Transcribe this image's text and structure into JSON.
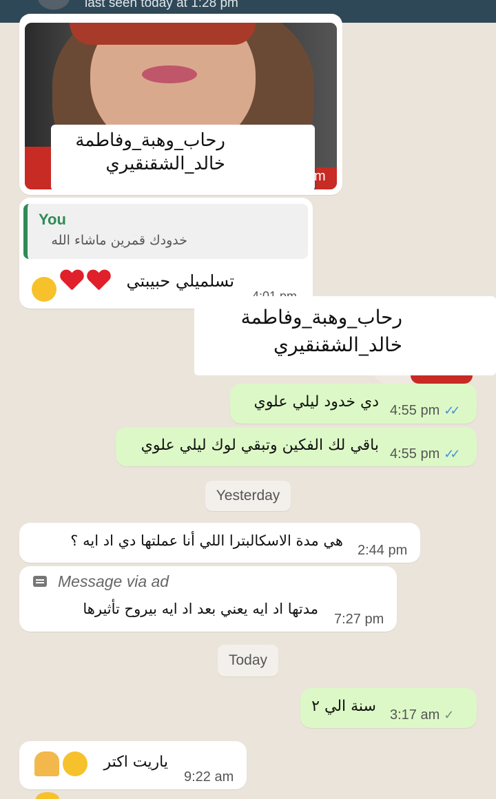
{
  "header": {
    "last_seen": "last seen today at 1:28 pm"
  },
  "photo_message": {
    "caption_line1": "رحاب_وهبة_وفاطمة",
    "caption_line2": "خالد_الشقنقيري",
    "time_fragment": "m"
  },
  "reply_message": {
    "quote_author": "You",
    "quote_text": "خدودك قمرين ماشاء الله",
    "text": "تسلميلي حبيبتي",
    "time_fragment": "4:01 pm"
  },
  "overlay_card": {
    "line1": "رحاب_وهبة_وفاطمة",
    "line2": "خالد_الشقنقيري"
  },
  "messages": [
    {
      "id": "m1",
      "direction": "out",
      "text": "دي خدود ليلي علوي",
      "time": "4:55 pm",
      "status": "read"
    },
    {
      "id": "m2",
      "direction": "out",
      "text": "باقي لك الفكين وتبقي لوك ليلي علوي",
      "time": "4:55 pm",
      "status": "read"
    },
    {
      "id": "m3",
      "direction": "in",
      "text": "هي مدة الاسكالبترا اللي أنا عملتها دي اد ايه ؟",
      "time": "2:44 pm"
    },
    {
      "id": "m4",
      "direction": "in",
      "ad_label": "Message via ad",
      "text": "مدتها اد ايه يعني بعد اد ايه بيروح تأثيرها",
      "time": "7:27 pm"
    },
    {
      "id": "m5",
      "direction": "out",
      "text": "سنة الي ٢",
      "time": "3:17 am",
      "status": "sent"
    },
    {
      "id": "m6",
      "direction": "in",
      "text": "ياريت اكتر",
      "time": "9:22 am"
    }
  ],
  "day_separators": {
    "yesterday": "Yesterday",
    "today": "Today"
  },
  "colors": {
    "header_bg": "#2f4858",
    "outgoing_bubble": "#dcf8c6",
    "incoming_bubble": "#ffffff",
    "read_ticks": "#4a8fd8",
    "quote_accent": "#2e8b57"
  },
  "icons": {
    "read_status": "double-check-icon",
    "sent_status": "single-check-icon",
    "ad": "message-ad-icon"
  }
}
